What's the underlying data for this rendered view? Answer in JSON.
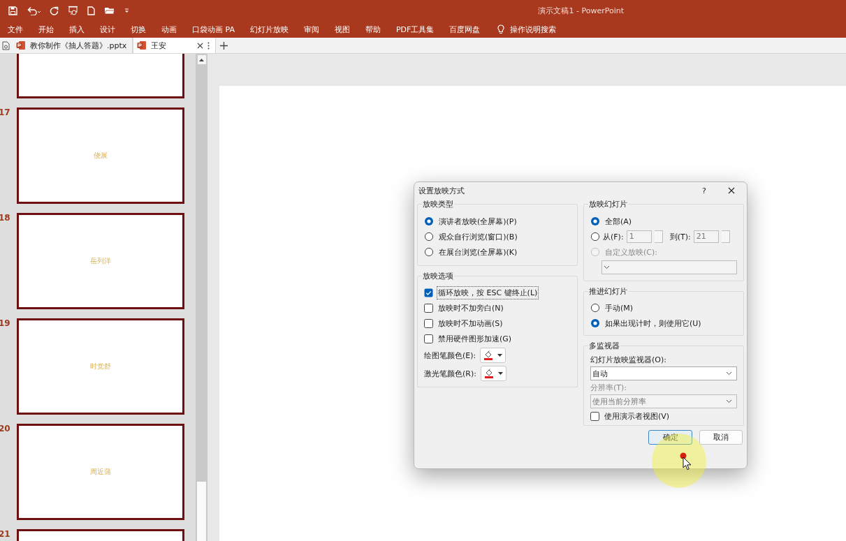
{
  "title_bar": {
    "title": "演示文稿1 - PowerPoint"
  },
  "ribbon_tabs": [
    "文件",
    "开始",
    "插入",
    "设计",
    "切换",
    "动画",
    "口袋动画 PA",
    "幻灯片放映",
    "审阅",
    "视图",
    "帮助",
    "PDF工具集",
    "百度网盘"
  ],
  "tell_me": "操作说明搜索",
  "doc_tabs": [
    {
      "label": "教你制作《抽人答题》.pptx",
      "selected": false
    },
    {
      "label": "王安",
      "selected": true
    }
  ],
  "slides": [
    {
      "number": "17",
      "text": "侥展"
    },
    {
      "number": "18",
      "text": "岳列洋"
    },
    {
      "number": "19",
      "text": "时党舒"
    },
    {
      "number": "20",
      "text": "周近蒲"
    },
    {
      "number": "21"
    }
  ],
  "dialog": {
    "title": "设置放映方式",
    "help": "?",
    "show_type": {
      "title": "放映类型",
      "options": [
        {
          "label": "演讲者放映(全屏幕)(P)",
          "selected": true
        },
        {
          "label": "观众自行浏览(窗口)(B)",
          "selected": false
        },
        {
          "label": "在展台浏览(全屏幕)(K)",
          "selected": false
        }
      ]
    },
    "show_options": {
      "title": "放映选项",
      "checks": [
        {
          "label": "循环放映，按 ESC 键终止(L)",
          "checked": true,
          "focused": true
        },
        {
          "label": "放映时不加旁白(N)",
          "checked": false,
          "focused": false
        },
        {
          "label": "放映时不加动画(S)",
          "checked": false,
          "focused": false
        },
        {
          "label": "禁用硬件图形加速(G)",
          "checked": false,
          "focused": false
        }
      ],
      "pen_color_label": "绘图笔颜色(E):",
      "laser_color_label": "激光笔颜色(R):"
    },
    "show_slides": {
      "title": "放映幻灯片",
      "options": [
        {
          "kind": "all",
          "label": "全部(A)",
          "selected": true
        },
        {
          "kind": "range",
          "label": "从(F):",
          "selected": false,
          "from_value": "1",
          "to_label": "到(T):",
          "to_value": "21"
        },
        {
          "kind": "custom",
          "label": "自定义放映(C):",
          "selected": false,
          "disabled": true
        }
      ]
    },
    "advance": {
      "title": "推进幻灯片",
      "options": [
        {
          "label": "手动(M)",
          "selected": false
        },
        {
          "label": "如果出现计时，则使用它(U)",
          "selected": true
        }
      ]
    },
    "monitors": {
      "title": "多监视器",
      "monitor_label": "幻灯片放映监视器(O):",
      "monitor_value": "自动",
      "resolution_label": "分辨率(T):",
      "resolution_value": "使用当前分辨率",
      "resolution_disabled": true,
      "presenter_view": {
        "label": "使用演示者视图(V)",
        "checked": false
      }
    },
    "buttons": [
      {
        "label": "确定",
        "default": true
      },
      {
        "label": "取消",
        "default": false
      }
    ]
  }
}
